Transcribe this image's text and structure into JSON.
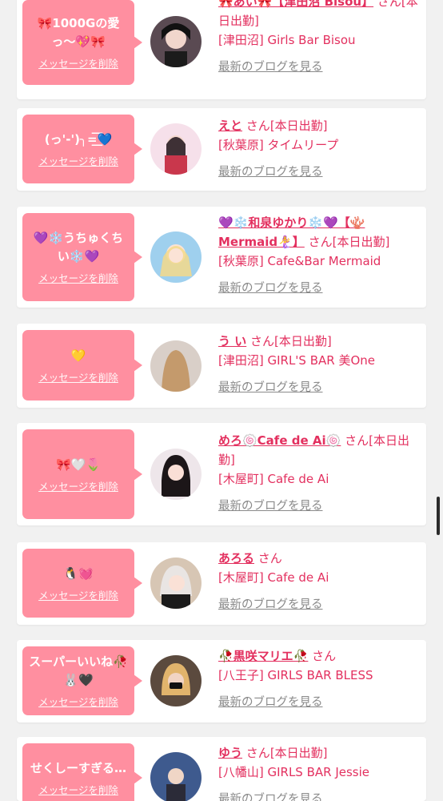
{
  "delete_label": "メッセージを削除",
  "blog_label": "最新のブログを見る",
  "san_label": "さん",
  "colors": {
    "accent": "#e3305f",
    "bubble": "#ff8fa0",
    "background": "#f1f1f1"
  },
  "cards": [
    {
      "message": "🎀1000Gの愛っ〜💖🎀",
      "name": "🎀あい🎀【津田沼 Bisou】",
      "status": "[本日出勤]",
      "shop": "[津田沼] Girls Bar Bisou",
      "avatar": "avatar-icon"
    },
    {
      "message": "(っ'-')╮=͟͟͞͞💙",
      "name": "えと",
      "status": "[本日出勤]",
      "shop": "[秋葉原] タイムリープ",
      "avatar": "avatar-icon"
    },
    {
      "message": "💜❄️うちゅくちい❄️💜",
      "name": "💜❄️和泉ゆかり❄️💜【🪸Mermaid🧜‍♀️】",
      "status": "[本日出勤]",
      "shop": "[秋葉原] Cafe&Bar Mermaid",
      "avatar": "avatar-icon"
    },
    {
      "message": "💛",
      "name": "う い",
      "status": "[本日出勤]",
      "shop": "[津田沼] GIRL'S BAR 美One",
      "avatar": "avatar-icon"
    },
    {
      "message": "🎀🤍🌷",
      "name": "めろ🍥Cafe de Ai🍥",
      "status": "[本日出勤]",
      "shop": "[木屋町] Cafe de Ai",
      "avatar": "avatar-icon"
    },
    {
      "message": "🐧💓",
      "name": "あろる",
      "status": "",
      "shop": "[木屋町] Cafe de Ai",
      "avatar": "avatar-icon"
    },
    {
      "message": "スーパーいいね🥀🐰🖤",
      "name": "🥀黒咲マリエ🥀",
      "status": "",
      "shop": "[八王子] GIRLS BAR BLESS",
      "avatar": "avatar-icon"
    },
    {
      "message": "せくしーすぎる…",
      "name": "ゆう",
      "status": "[本日出勤]",
      "shop": "[八幡山] GIRLS BAR Jessie",
      "avatar": "avatar-icon"
    }
  ]
}
